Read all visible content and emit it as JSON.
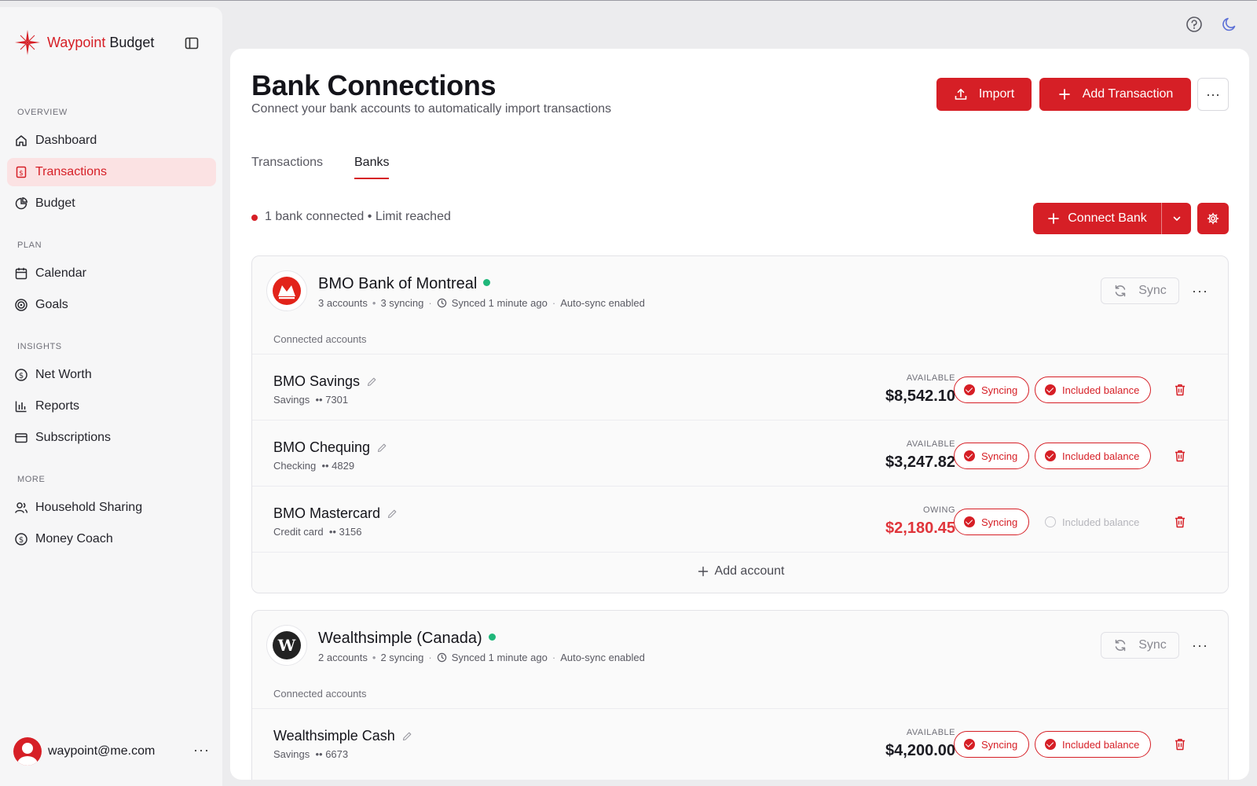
{
  "app": {
    "brand_part1": "Waypoint",
    "brand_part2": " Budget"
  },
  "sidebar": {
    "sections": [
      "OVERVIEW",
      "PLAN",
      "INSIGHTS",
      "MORE"
    ],
    "items": [
      {
        "label": "Dashboard",
        "icon": "home-icon"
      },
      {
        "label": "Transactions",
        "icon": "receipt-icon",
        "active": true
      },
      {
        "label": "Budget",
        "icon": "pie-chart-icon"
      },
      {
        "label": "Calendar",
        "icon": "calendar-icon"
      },
      {
        "label": "Goals",
        "icon": "target-icon"
      },
      {
        "label": "Net Worth",
        "icon": "dollar-circle-icon"
      },
      {
        "label": "Reports",
        "icon": "bar-chart-icon"
      },
      {
        "label": "Subscriptions",
        "icon": "card-icon"
      },
      {
        "label": "Household Sharing",
        "icon": "users-icon"
      },
      {
        "label": "Money Coach",
        "icon": "dollar-circle-icon"
      }
    ],
    "user_email": "waypoint@me.com",
    "user_more": "···"
  },
  "header": {
    "title": "Bank Connections",
    "subtitle": "Connect your bank accounts to automatically import transactions",
    "import_label": "Import",
    "add_transaction_label": "Add Transaction",
    "more_label": "···"
  },
  "tabs": [
    {
      "label": "Transactions"
    },
    {
      "label": "Banks",
      "active": true
    }
  ],
  "status": {
    "text": "1 bank connected • Limit reached"
  },
  "connect_bank_label": "Connect Bank",
  "colors": {
    "accent": "#d61f26",
    "online": "#1fb77a",
    "owing": "#e0353b"
  },
  "banks": [
    {
      "name": "BMO Bank of Montreal",
      "accounts_count": "3 accounts",
      "syncing_count": "3 syncing",
      "synced": "Synced 1 minute ago",
      "auto_sync": "Auto-sync enabled",
      "sync_label": "Sync",
      "connected_label": "Connected accounts",
      "add_account_label": "Add account",
      "accounts": [
        {
          "name": "BMO Savings",
          "type": "Savings",
          "mask": "•• 7301",
          "amount_label": "AVAILABLE",
          "amount": "$8,542.10",
          "syncing": "Syncing",
          "included": "Included balance",
          "included_on": true
        },
        {
          "name": "BMO Chequing",
          "type": "Checking",
          "mask": "•• 4829",
          "amount_label": "AVAILABLE",
          "amount": "$3,247.82",
          "syncing": "Syncing",
          "included": "Included balance",
          "included_on": true
        },
        {
          "name": "BMO Mastercard",
          "type": "Credit card",
          "mask": "•• 3156",
          "amount_label": "OWING",
          "amount": "$2,180.45",
          "syncing": "Syncing",
          "included": "Included balance",
          "included_on": false
        }
      ]
    },
    {
      "name": "Wealthsimple (Canada)",
      "accounts_count": "2 accounts",
      "syncing_count": "2 syncing",
      "synced": "Synced 1 minute ago",
      "auto_sync": "Auto-sync enabled",
      "sync_label": "Sync",
      "connected_label": "Connected accounts",
      "accounts": [
        {
          "name": "Wealthsimple Cash",
          "type": "Savings",
          "mask": "•• 6673",
          "amount_label": "AVAILABLE",
          "amount": "$4,200.00",
          "syncing": "Syncing",
          "included": "Included balance",
          "included_on": true
        }
      ]
    }
  ]
}
